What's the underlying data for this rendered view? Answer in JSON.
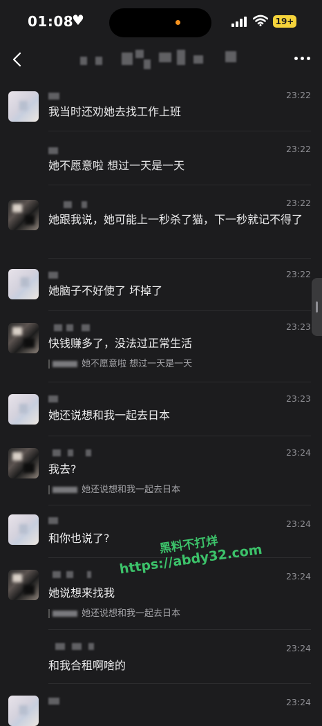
{
  "status_bar": {
    "time": "01:08",
    "battery": "19+"
  },
  "messages": [
    {
      "time": "23:22",
      "text": "我当时还劝她去找工作上班",
      "quote": ""
    },
    {
      "time": "23:22",
      "text": "她不愿意啦 想过一天是一天",
      "quote": ""
    },
    {
      "time": "23:22",
      "text": "她跟我说，她可能上一秒杀了猫，下一秒就记不得了",
      "quote": ""
    },
    {
      "time": "23:22",
      "text": "她脑子不好使了 坏掉了",
      "quote": ""
    },
    {
      "time": "23:23",
      "text": "快钱赚多了，没法过正常生活",
      "quote": "她不愿意啦 想过一天是一天"
    },
    {
      "time": "23:23",
      "text": "她还说想和我一起去日本",
      "quote": ""
    },
    {
      "time": "23:24",
      "text": "我去?",
      "quote": "她还说想和我一起去日本"
    },
    {
      "time": "23:24",
      "text": "和你也说了?",
      "quote": ""
    },
    {
      "time": "23:24",
      "text": "她说想来找我",
      "quote": "她还说想和我一起去日本"
    },
    {
      "time": "23:24",
      "text": "和我合租啊啥的",
      "quote": ""
    },
    {
      "time": "23:24",
      "text": "",
      "quote": ""
    }
  ],
  "watermark": {
    "line1": "黑料不打烊",
    "line2": "https://abdy32.com"
  }
}
